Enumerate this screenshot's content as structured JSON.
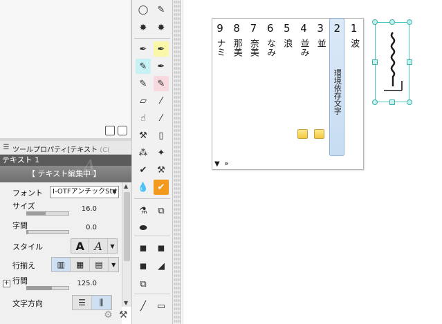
{
  "property_panel": {
    "header_title": "ツールプロパティ[テキスト",
    "header_cut": "(C(",
    "tool_name": "テキスト 1",
    "editing_banner": "【 テキスト編集中 】",
    "font": {
      "label": "フォント",
      "value": "I-OTFアンチックStd B"
    },
    "size": {
      "label": "サイズ",
      "value": "16.0",
      "fraction": 0.45
    },
    "spacing": {
      "label": "字間",
      "value": "0.0",
      "fraction": 0.0
    },
    "style": {
      "label": "スタイル"
    },
    "align": {
      "label": "行揃え"
    },
    "line_spacing": {
      "label": "行間",
      "value": "125.0",
      "fraction": 0.6
    },
    "direction": {
      "label": "文字方向"
    }
  },
  "glyph_palette": {
    "columns": [
      {
        "num": "9",
        "chars": "ナミ"
      },
      {
        "num": "8",
        "chars": "那美"
      },
      {
        "num": "7",
        "chars": "奈美"
      },
      {
        "num": "6",
        "chars": "なみ"
      },
      {
        "num": "5",
        "chars": "浪"
      },
      {
        "num": "4",
        "chars": "並み"
      },
      {
        "num": "3",
        "chars": "並"
      },
      {
        "num": "2",
        "chars": "環境依存文字"
      },
      {
        "num": "1",
        "chars": "波"
      }
    ]
  },
  "colors": {
    "accent_orange": "#f39a1e",
    "selection_blue": "#c7dcf2",
    "frame_teal": "#4ac9c0"
  }
}
